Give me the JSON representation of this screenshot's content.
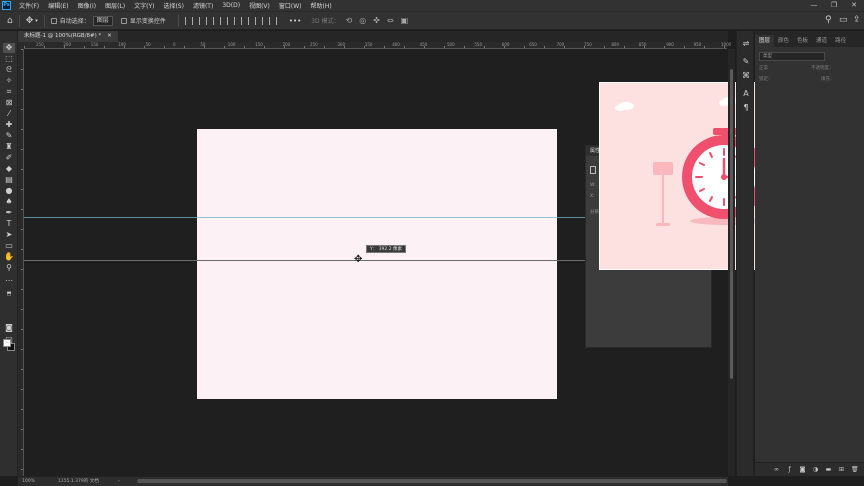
{
  "menubar": {
    "logo": "Ps",
    "items": [
      "文件(F)",
      "编辑(E)",
      "图像(I)",
      "图层(L)",
      "文字(Y)",
      "选择(S)",
      "滤镜(T)",
      "3D(D)",
      "视图(V)",
      "窗口(W)",
      "帮助(H)"
    ],
    "window_controls": [
      "—",
      "❐",
      "✕"
    ]
  },
  "options": {
    "auto_select_label": "自动选择：",
    "auto_select_target": "图层",
    "show_transform_label": "显示变换控件",
    "more": "•••",
    "mode_3d_label": "3D 模式："
  },
  "document": {
    "tab_title": "未标题-1 @ 100%(RGB/8#) *",
    "tab_close": "✕"
  },
  "ruler": {
    "h_labels": [
      "250",
      "200",
      "150",
      "100",
      "50",
      "0",
      "50",
      "100",
      "150",
      "200",
      "250",
      "300",
      "350",
      "400",
      "450",
      "500",
      "550",
      "600",
      "650",
      "700",
      "750",
      "800",
      "850",
      "900",
      "950",
      "1000"
    ]
  },
  "canvas": {
    "tooltip": "Y： 392.2 像素",
    "artboard_color": "#fcf1f4",
    "guide_color": "#6fb4c8"
  },
  "properties_panel": {
    "title": "属性",
    "row1": "W:",
    "row2": "X:",
    "row3": "分辨"
  },
  "popup": {
    "bg_color": "#fde1e0",
    "clock_color": "#f0506e",
    "leaf_color": "#7b9de0",
    "leaf_orange": "#f6a37c"
  },
  "layers_panel": {
    "tabs": [
      "图层",
      "颜色",
      "色板",
      "通道",
      "路径"
    ],
    "active_tab": "图层",
    "filter_label": "类型",
    "mode_label": "正常",
    "opacity_label": "不透明度：",
    "lock_label": "锁定：",
    "fill_label": "填充："
  },
  "status": {
    "zoom": "100%",
    "doc_info": "1155.1.379的 文档",
    "nav": "›"
  }
}
